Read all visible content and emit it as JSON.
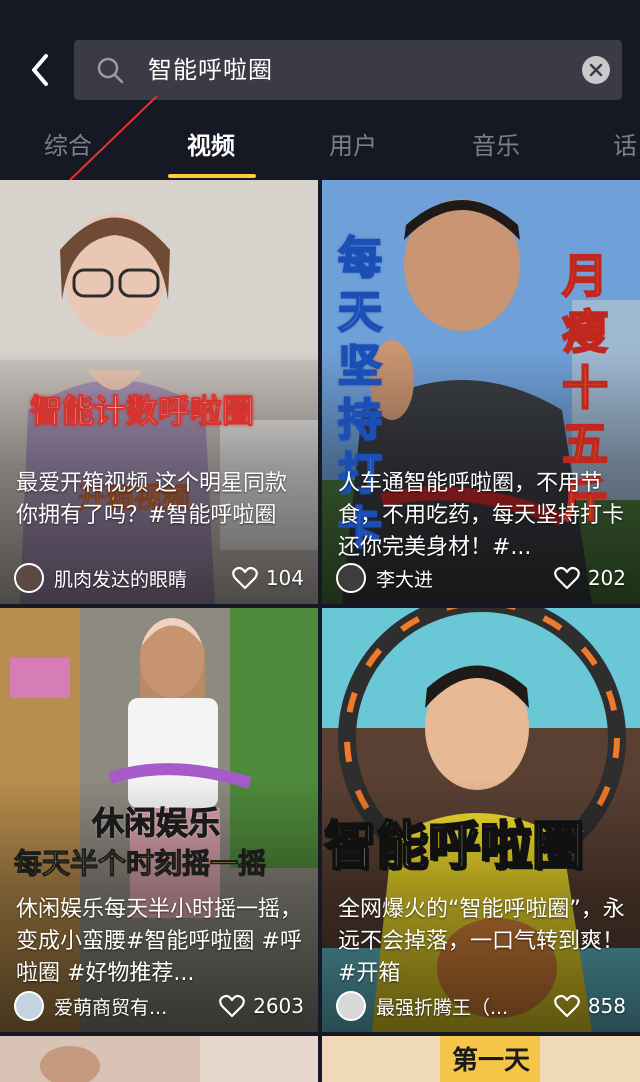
{
  "search": {
    "query": "智能呼啦圈",
    "back_icon": "chevron-left-icon",
    "search_icon": "search-icon",
    "clear_icon": "clear-icon"
  },
  "tabs": [
    {
      "label": "综合",
      "active": false
    },
    {
      "label": "视频",
      "active": true
    },
    {
      "label": "用户",
      "active": false
    },
    {
      "label": "音乐",
      "active": false
    },
    {
      "label": "话",
      "active": false
    }
  ],
  "colors": {
    "background": "#161823",
    "search_box": "#3a3b44",
    "tab_inactive": "#7d7e86",
    "tab_underline": "#facd3c",
    "annotation_line": "#e8322f"
  },
  "videos": [
    {
      "overlay_text": "智能计数呼啦圈",
      "overlay_text_2": "开箱视频",
      "caption": "最爱开箱视频 这个明星同款你拥有了吗？#智能呼啦圈",
      "author": "肌肉发达的眼睛",
      "likes": "104"
    },
    {
      "overlay_text": "每天坚持打卡",
      "overlay_text_2": "月瘦十五斤",
      "caption": "人车通智能呼啦圈，不用节食，不用吃药，每天坚持打卡还你完美身材！#...",
      "author": "李大进",
      "likes": "202"
    },
    {
      "overlay_text": "休闲娱乐",
      "overlay_text_2": "每天半个时刻摇一摇",
      "caption": "休闲娱乐每天半小时摇一摇，变成小蛮腰#智能呼啦圈 #呼啦圈 #好物推荐...",
      "author": "爱萌商贸有...",
      "likes": "2603"
    },
    {
      "overlay_text": "智能呼啦圈",
      "caption": "全网爆火的“智能呼啦圈”，永远不会掉落，一口气转到爽！#开箱",
      "author": "最强折腾王（...",
      "likes": "858"
    },
    {
      "overlay_text": ""
    },
    {
      "overlay_text": "第一天"
    }
  ]
}
